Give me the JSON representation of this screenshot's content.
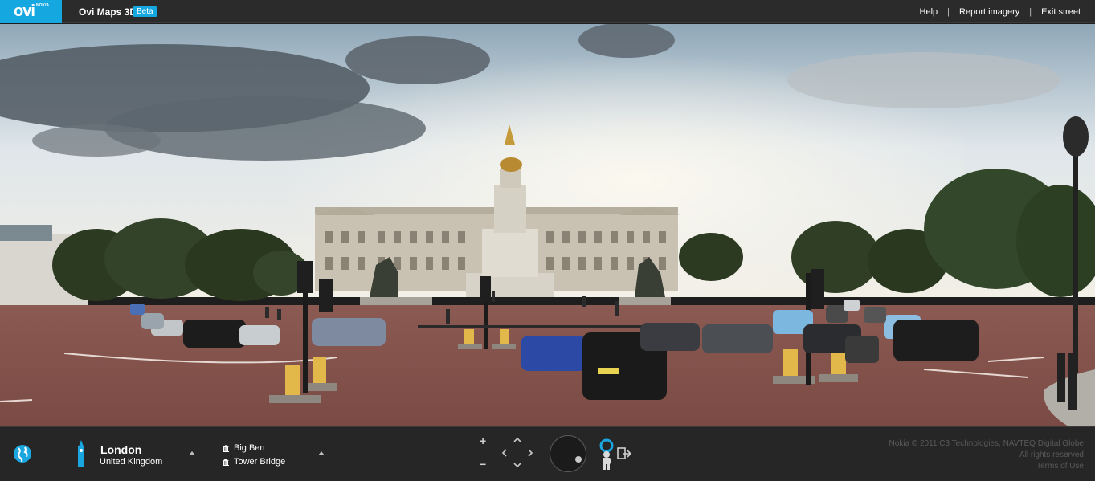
{
  "header": {
    "logo_text": "ovi",
    "logo_sub": "NOKIA",
    "app_title": "Ovi Maps 3D",
    "beta_badge": "Beta",
    "links": {
      "help": "Help",
      "report": "Report imagery",
      "exit": "Exit street"
    },
    "separator": "|"
  },
  "location": {
    "city": "London",
    "country": "United Kingdom"
  },
  "places": [
    {
      "label": "Big Ben"
    },
    {
      "label": "Tower Bridge"
    }
  ],
  "controls": {
    "zoom_in": "+",
    "zoom_out": "−"
  },
  "credits": {
    "copyright": "Nokia © 2011 C3 Technologies, NAVTEQ Digital Globe",
    "rights": "All rights reserved",
    "terms": "Terms of Use"
  },
  "icons": {
    "globe": "globe-icon",
    "city": "big-ben-icon",
    "landmark": "landmark-icon",
    "pegman": "person-icon",
    "exit": "exit-icon"
  },
  "colors": {
    "accent": "#15a7e0",
    "bar": "#262626"
  }
}
